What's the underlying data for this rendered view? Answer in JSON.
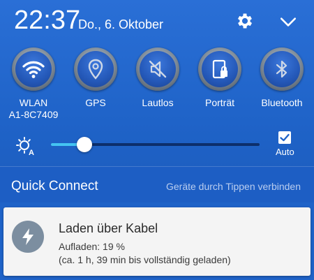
{
  "status": {
    "time": "22:37",
    "date": "Do., 6. Oktober",
    "settings_icon": "gear-icon",
    "expand_icon": "chevron-down-icon"
  },
  "toggles": [
    {
      "label": "WLAN",
      "sublabel": "A1-8C7409",
      "icon": "wifi-icon"
    },
    {
      "label": "GPS",
      "sublabel": "",
      "icon": "location-pin-icon"
    },
    {
      "label": "Lautlos",
      "sublabel": "",
      "icon": "mute-icon"
    },
    {
      "label": "Porträt",
      "sublabel": "",
      "icon": "portrait-lock-icon"
    },
    {
      "label": "Bluetooth",
      "sublabel": "",
      "icon": "bluetooth-icon"
    }
  ],
  "brightness": {
    "icon": "brightness-auto-icon",
    "level": 0.16,
    "auto_checked": true,
    "auto_label": "Auto"
  },
  "quick_connect": {
    "title": "Quick Connect",
    "hint": "Geräte durch Tippen verbinden"
  },
  "notification": {
    "icon": "lightning-bolt-icon",
    "title": "Laden über Kabel",
    "line1": "Aufladen: 19 %",
    "line2": "(ca. 1 h, 39 min bis vollständig geladen)"
  },
  "colors": {
    "panel_blue": "#1f63c8",
    "slider_accent": "#44c4f2",
    "notification_bg": "#f4f4f4"
  }
}
